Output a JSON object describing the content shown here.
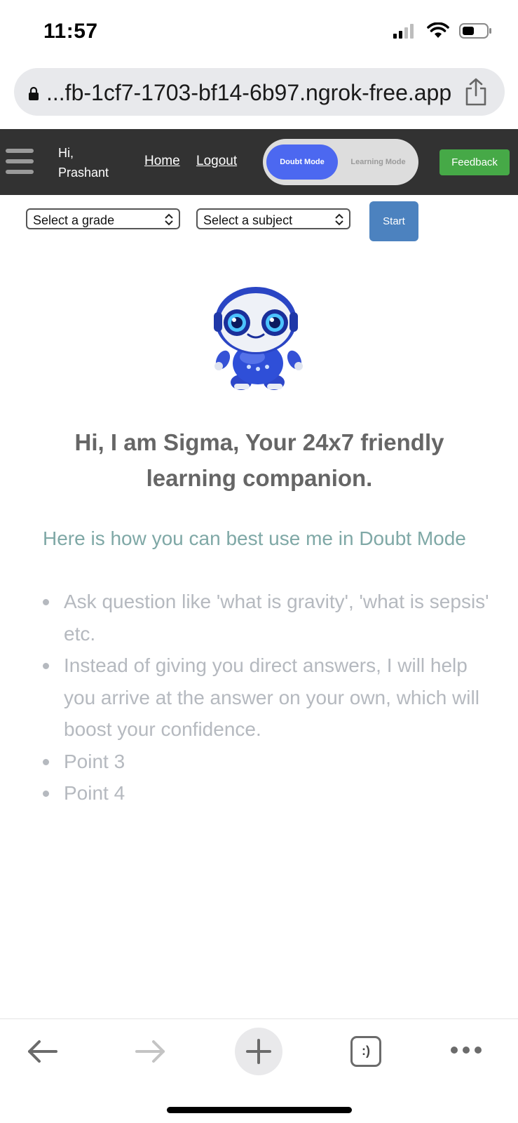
{
  "status_bar": {
    "time": "11:57"
  },
  "browser": {
    "url": "...fb-1cf7-1703-bf14-6b97.ngrok-free.app"
  },
  "nav": {
    "greeting_line1": "Hi,",
    "greeting_line2": "Prashant",
    "home": "Home",
    "logout": "Logout",
    "mode_active": "Doubt Mode",
    "mode_inactive": "Learning Mode",
    "feedback": "Feedback"
  },
  "controls": {
    "grade_select": "Select a grade",
    "subject_select": "Select a subject",
    "start": "Start"
  },
  "main": {
    "headline_line1": "Hi, I am Sigma, Your 24x7 friendly",
    "headline_line2": "learning companion.",
    "howto": "Here is how you can best use me in Doubt Mode",
    "points": [
      "Ask question like 'what is gravity', 'what is sepsis' etc.",
      "Instead of giving you direct answers, I will help you arrive at the answer on your own, which will boost your confidence.",
      "Point 3",
      "Point 4"
    ]
  },
  "toolbar": {
    "tabs_label": ":)"
  },
  "colors": {
    "nav_bg": "#323232",
    "toggle_active": "#4c68f0",
    "feedback_green": "#46a947",
    "start_blue": "#4c82bf",
    "howto_teal": "#7fa8a6"
  }
}
